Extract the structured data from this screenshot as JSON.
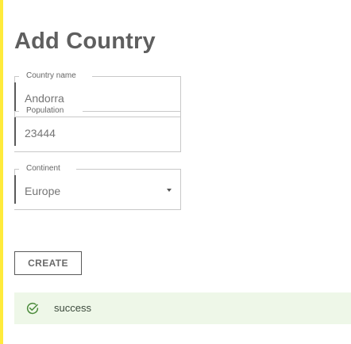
{
  "form": {
    "title": "Add Country",
    "fields": [
      {
        "label": "Country name",
        "value": "Andorra"
      },
      {
        "label": "Population",
        "value": "23444"
      },
      {
        "label": "Continent",
        "value": "Europe"
      }
    ],
    "submit_label": "CREATE"
  },
  "alert": {
    "message": "success",
    "icon": "check-circle-icon",
    "background": "#eef7e8",
    "icon_color": "#4a8a3a"
  },
  "colors": {
    "page_left_accent": "#ffeb3b",
    "title": "#5f5f5f"
  }
}
